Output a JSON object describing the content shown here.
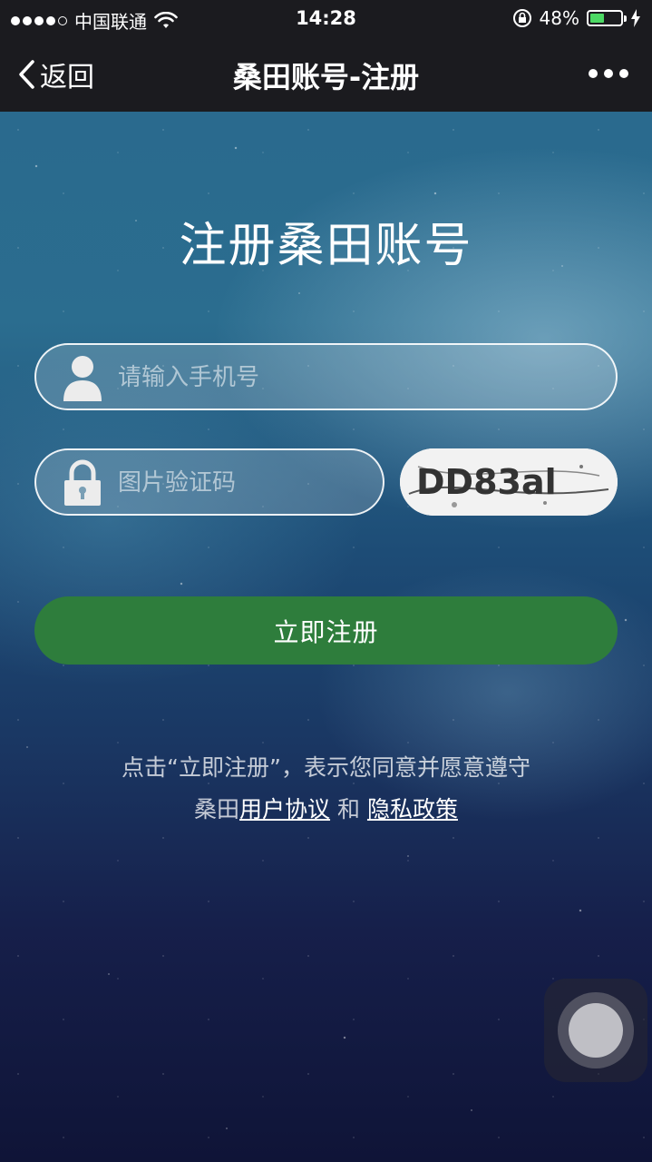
{
  "status_bar": {
    "carrier": "中国联通",
    "time": "14:28",
    "battery_percent": "48%",
    "battery_level": 0.48,
    "signal_bars": 4,
    "icons": [
      "signal-dots-icon",
      "wifi-icon",
      "orientation-lock-icon",
      "battery-icon",
      "charging-bolt-icon"
    ]
  },
  "nav": {
    "back_label": "返回",
    "title": "桑田账号-注册",
    "more_icon": "more-dots-icon"
  },
  "page": {
    "title": "注册桑田账号"
  },
  "form": {
    "phone": {
      "placeholder": "请输入手机号",
      "value": "",
      "icon": "user-icon"
    },
    "captcha": {
      "placeholder": "图片验证码",
      "value": "",
      "icon": "lock-icon",
      "image_text": "DD83al"
    },
    "submit_label": "立即注册"
  },
  "terms": {
    "line1": "点击“立即注册”，表示您同意并愿意遵守",
    "prefix": "桑田",
    "user_agreement": "用户协议",
    "and": " 和 ",
    "privacy_policy": "隐私政策"
  },
  "colors": {
    "accent_green": "#2e7d3c",
    "nav_bg": "#1b1b1f",
    "battery_green": "#4cd964"
  }
}
